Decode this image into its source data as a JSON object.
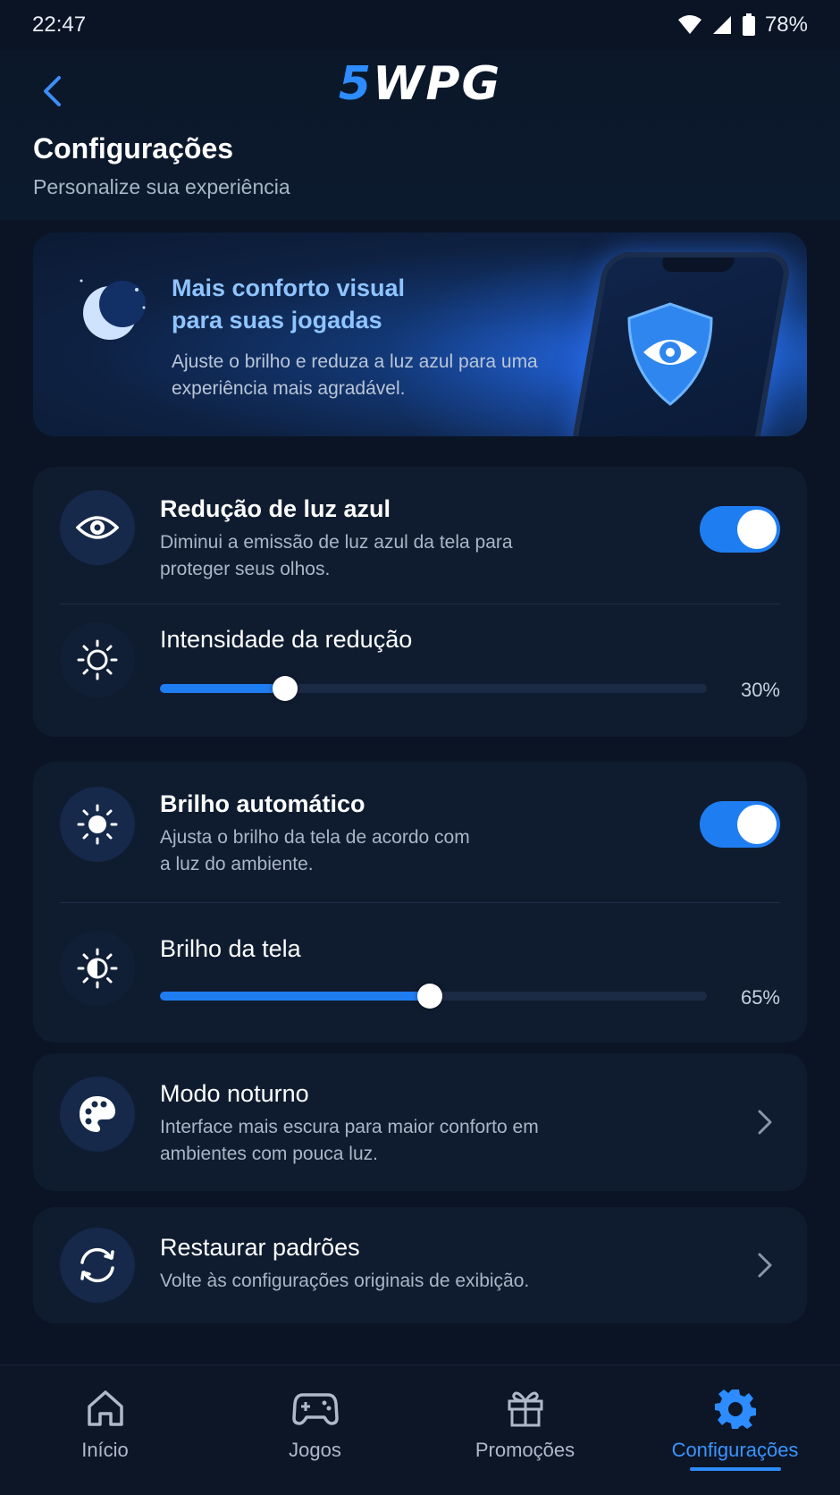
{
  "status_bar": {
    "time": "22:47",
    "battery": "78%"
  },
  "header": {
    "logo_accent": "5",
    "logo_text": "WPG",
    "title": "Configurações",
    "subtitle": "Personalize sua experiência"
  },
  "hero": {
    "title": "Mais conforto visual para suas jogadas",
    "description": "Ajuste o brilho e reduza a luz azul para uma experiência mais agradável."
  },
  "blue_light": {
    "title": "Redução de luz azul",
    "description": "Diminui a emissão de luz azul da tela para proteger seus olhos.",
    "enabled": true,
    "intensity_label": "Intensidade da redução",
    "intensity_value": 30,
    "intensity_text": "30%"
  },
  "brightness": {
    "auto_title": "Brilho automático",
    "auto_description": "Ajusta o brilho da tela de acordo com a luz do ambiente.",
    "auto_enabled": true,
    "screen_label": "Brilho da tela",
    "screen_value": 65,
    "screen_text": "65%"
  },
  "night_mode": {
    "title": "Modo noturno",
    "description": "Interface mais escura para maior conforto em ambientes com pouca luz."
  },
  "restore": {
    "title": "Restaurar padrões",
    "description": "Volte às configurações originais de exibição."
  },
  "bottom_nav": {
    "items": [
      {
        "label": "Início",
        "icon": "home-icon"
      },
      {
        "label": "Jogos",
        "icon": "gamepad-icon"
      },
      {
        "label": "Promoções",
        "icon": "gift-icon"
      },
      {
        "label": "Configurações",
        "icon": "gear-icon",
        "active": true
      }
    ]
  },
  "colors": {
    "accent": "#1f7df2",
    "background": "#0a1424",
    "card": "#0f1c30"
  }
}
